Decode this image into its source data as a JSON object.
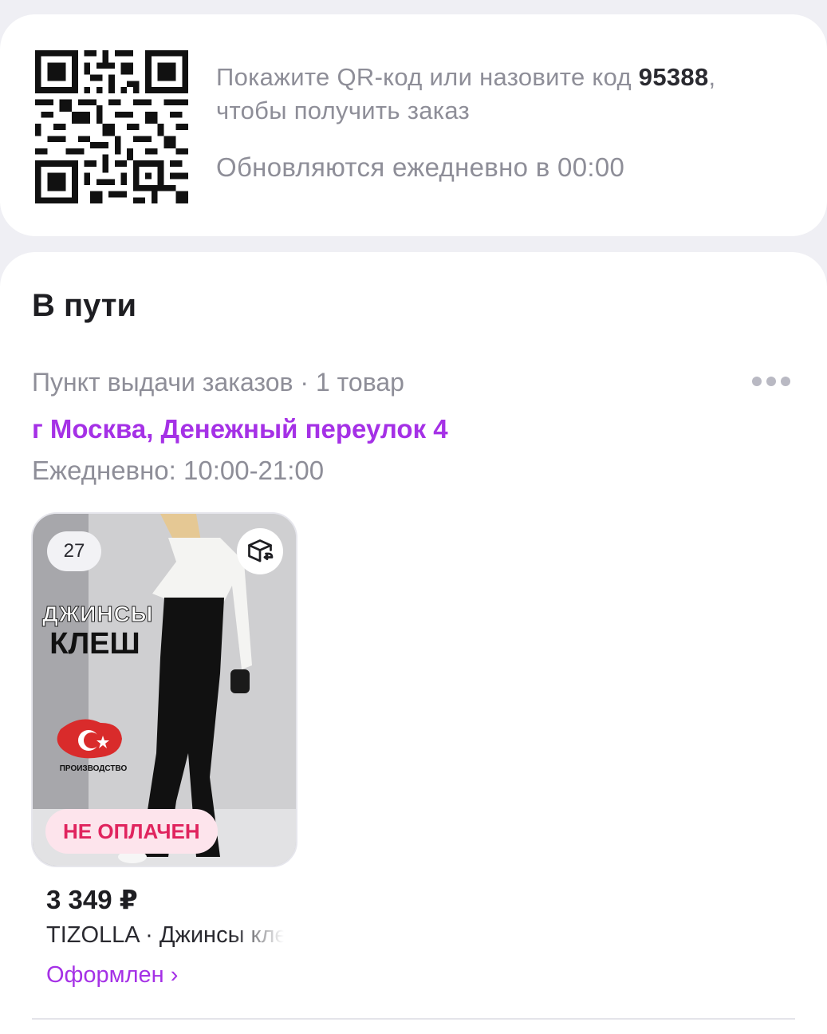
{
  "qr_card": {
    "instruction_prefix": "Покажите QR-код или назовите код ",
    "code": "95388",
    "instruction_suffix": ", чтобы получить заказ",
    "update_note": "Обновляются ежедневно в 00:00"
  },
  "orders": {
    "section_title": "В пути",
    "pickup_meta": "Пункт выдачи заказов · 1 товар",
    "address": "г Москва, Денежный переулок 4",
    "hours": "Ежедневно: 10:00-21:00",
    "more_icon": "more-horizontal-icon",
    "product": {
      "count_badge": "27",
      "return_icon": "box-return-icon",
      "promo_line1": "ДЖИНСЫ",
      "promo_line2": "КЛЕШ",
      "promo_made": "ПРОИЗВОДСТВО",
      "payment_badge": "НЕ ОПЛАЧЕН",
      "price": "3 349 ₽",
      "name": "TIZOLLA · Джинсы клеш",
      "status": "Оформлен ›"
    }
  },
  "colors": {
    "accent": "#a531e6",
    "unpaid": "#e0245e",
    "unpaid_bg": "#fde4ec",
    "muted_text": "#8e8e98",
    "page_bg": "#efeff4"
  }
}
